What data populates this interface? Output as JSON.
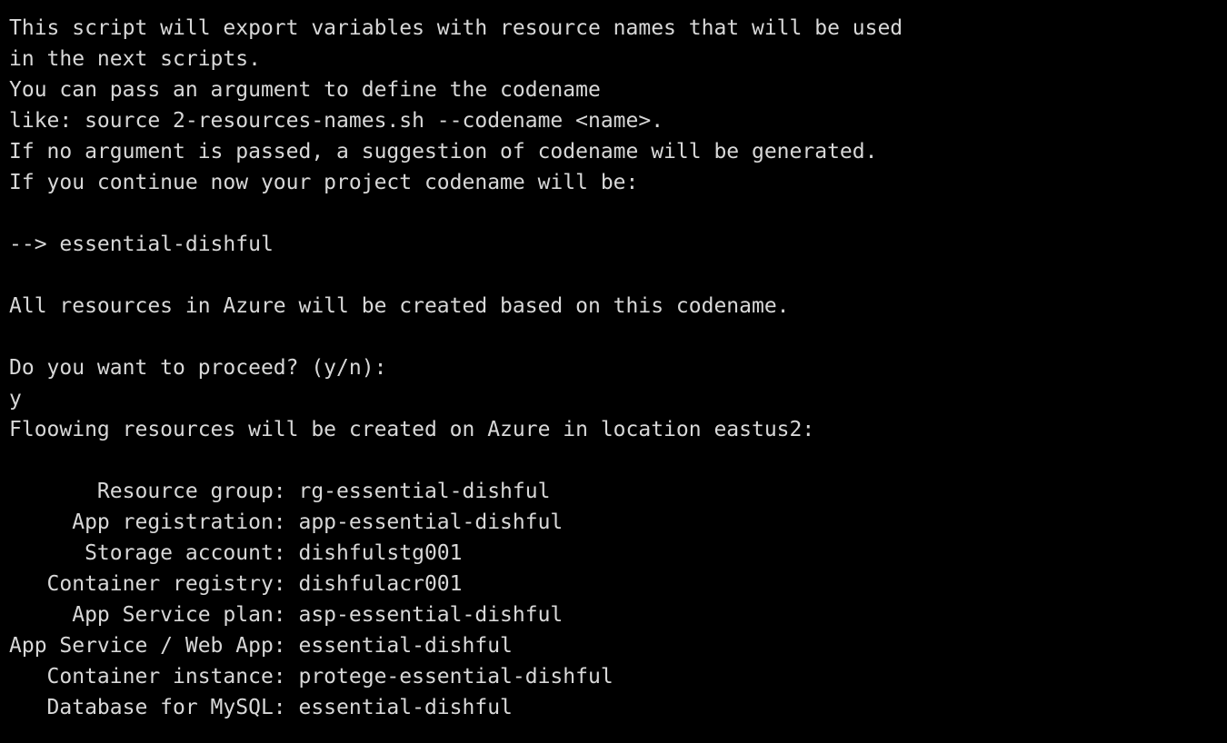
{
  "colors": {
    "background": "#000000",
    "text": "#d8d8d8"
  },
  "terminal": {
    "lines": [
      "This script will export variables with resource names that will be used",
      "in the next scripts.",
      "You can pass an argument to define the codename",
      "like: source 2-resources-names.sh --codename <name>.",
      "If no argument is passed, a suggestion of codename will be generated.",
      "If you continue now your project codename will be:",
      "",
      "--> essential-dishful",
      "",
      "All resources in Azure will be created based on this codename.",
      "",
      "Do you want to proceed? (y/n):",
      "y",
      "Floowing resources will be created on Azure in location eastus2:",
      "",
      "       Resource group: rg-essential-dishful",
      "     App registration: app-essential-dishful",
      "      Storage account: dishfulstg001",
      "   Container registry: dishfulacr001",
      "     App Service plan: asp-essential-dishful",
      "App Service / Web App: essential-dishful",
      "   Container instance: protege-essential-dishful",
      "   Database for MySQL: essential-dishful"
    ]
  }
}
